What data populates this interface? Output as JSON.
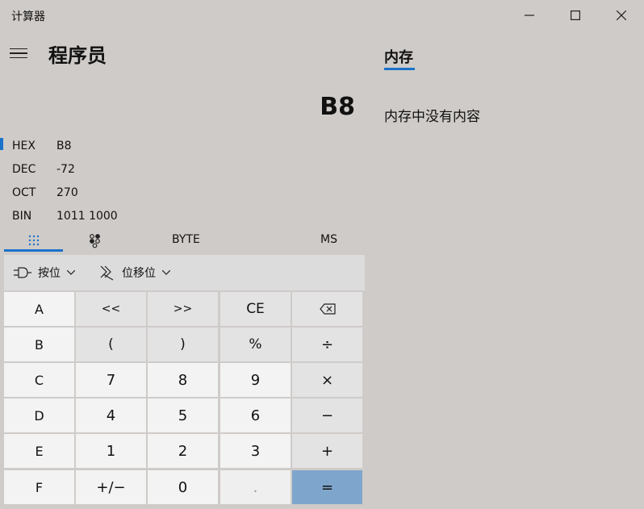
{
  "window": {
    "title": "计算器"
  },
  "header": {
    "mode_title": "程序员"
  },
  "display": {
    "value": "B8"
  },
  "radix": [
    {
      "name": "HEX",
      "value": "B8",
      "active": true
    },
    {
      "name": "DEC",
      "value": "-72",
      "active": false
    },
    {
      "name": "OCT",
      "value": "270",
      "active": false
    },
    {
      "name": "BIN",
      "value": "1011 1000",
      "active": false
    }
  ],
  "tabs": {
    "word_size": "BYTE",
    "memory_store": "MS"
  },
  "operators": {
    "bitwise": "按位",
    "bitshift": "位移位"
  },
  "keypad": {
    "rows": [
      [
        "A",
        "<<",
        ">>",
        "CE",
        "⌫"
      ],
      [
        "B",
        "(",
        ")",
        "%",
        "÷"
      ],
      [
        "C",
        "7",
        "8",
        "9",
        "×"
      ],
      [
        "D",
        "4",
        "5",
        "6",
        "−"
      ],
      [
        "E",
        "1",
        "2",
        "3",
        "+"
      ],
      [
        "F",
        "+/−",
        "0",
        ".",
        "="
      ]
    ]
  },
  "memory": {
    "title": "内存",
    "empty_text": "内存中没有内容"
  },
  "colors": {
    "accent": "#1a73c9",
    "equals_key": "#7ea6cd",
    "background": "#cfcbc8"
  }
}
